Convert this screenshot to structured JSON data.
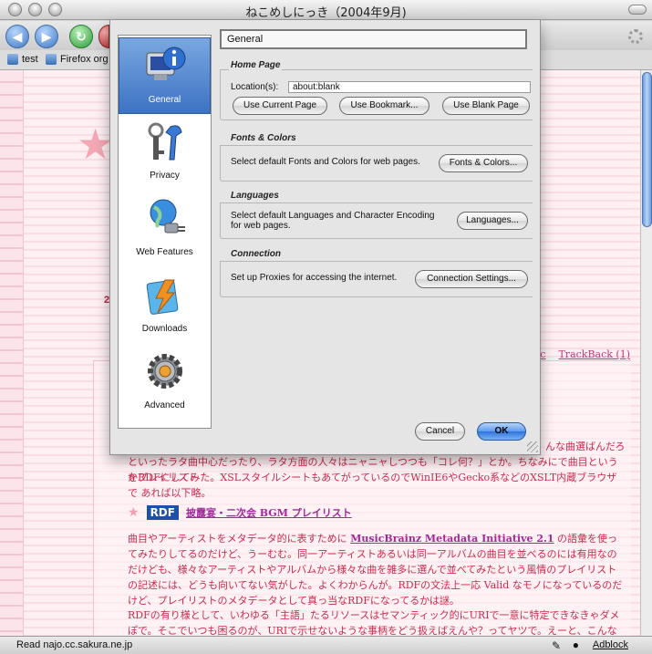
{
  "window": {
    "title": "ねこめしにっき（2004年9月)",
    "status": "Read najo.cc.sakura.ne.jp",
    "adblock": "Adblock"
  },
  "bookmarks": [
    {
      "label": "test"
    },
    {
      "label": "Firefox org"
    }
  ],
  "page": {
    "side_num": "2",
    "links": [
      "usic",
      "TrackBack (1)"
    ],
    "p0": "といったラタ曲中心だったり、ラタ方面の人々はニャニャしつつも「コレ何？」とか。ちなみにで曲目というかプレイリスト",
    "p0b": "をRDFにしてみた。XSLスタイルシートもあてがっているのでWinIE6やGecko系などのXSLT内蔵ブラウザで あれば以下略。",
    "p0_tail": "んな曲選ばんだろ",
    "rdf_badge": "RDF",
    "rdf_link": "披露宴・二次会 BGM プレイリスト",
    "p1_a": "曲目やアーティストをメタデータ的に表すために",
    "p1_link": "MusicBrainz Metadata Initiative 2.1",
    "p1_b": "の語彙を使ってみたりしてるのだけど、うーむむ。同一アーティストあるいは同一アルバムの曲目を並べるのには有用なのだけども、様々なアーティストやアルバムから様々な曲を雑多に選んで並べてみたという風情のプレイリストの記述には、どうも向いてない気がした。よくわからんが。RDFの文法上一応 Valid なモノになっているのだけど、プレイリストのメタデータとして真っ当なRDFになってるかは謎。",
    "p2": "RDFの有り様として、いわゆる「主語」たるリソースはセマンティック的にURIで一意に特定できなきゃダメぽで。そこでいつも困るのが、URIで示せないような事柄をどう扱えばえんや？ってヤツで。えーと、こんなことを今だに口"
  },
  "prefs": {
    "categories": [
      {
        "label": "General",
        "icon": "general-icon",
        "selected": true
      },
      {
        "label": "Privacy",
        "icon": "privacy-icon",
        "selected": false
      },
      {
        "label": "Web Features",
        "icon": "web-features-icon",
        "selected": false
      },
      {
        "label": "Downloads",
        "icon": "downloads-icon",
        "selected": false
      },
      {
        "label": "Advanced",
        "icon": "advanced-icon",
        "selected": false
      }
    ],
    "panel_title": "General",
    "homepage": {
      "title": "Home Page",
      "location_label": "Location(s):",
      "location_value": "about:blank",
      "use_current": "Use Current Page",
      "use_bookmark": "Use Bookmark...",
      "use_blank": "Use Blank Page"
    },
    "fonts": {
      "title": "Fonts & Colors",
      "desc": "Select default Fonts and Colors for web pages.",
      "button": "Fonts & Colors..."
    },
    "languages": {
      "title": "Languages",
      "desc1": "Select default Languages and Character Encoding",
      "desc2": "for web pages.",
      "button": "Languages..."
    },
    "connection": {
      "title": "Connection",
      "desc": "Set up Proxies for accessing the internet.",
      "button": "Connection Settings..."
    },
    "cancel": "Cancel",
    "ok": "OK"
  },
  "colors": {
    "accent_blue": "#3d73c4",
    "link_pink": "#c23a7a",
    "text_red": "#cc2a4e"
  }
}
